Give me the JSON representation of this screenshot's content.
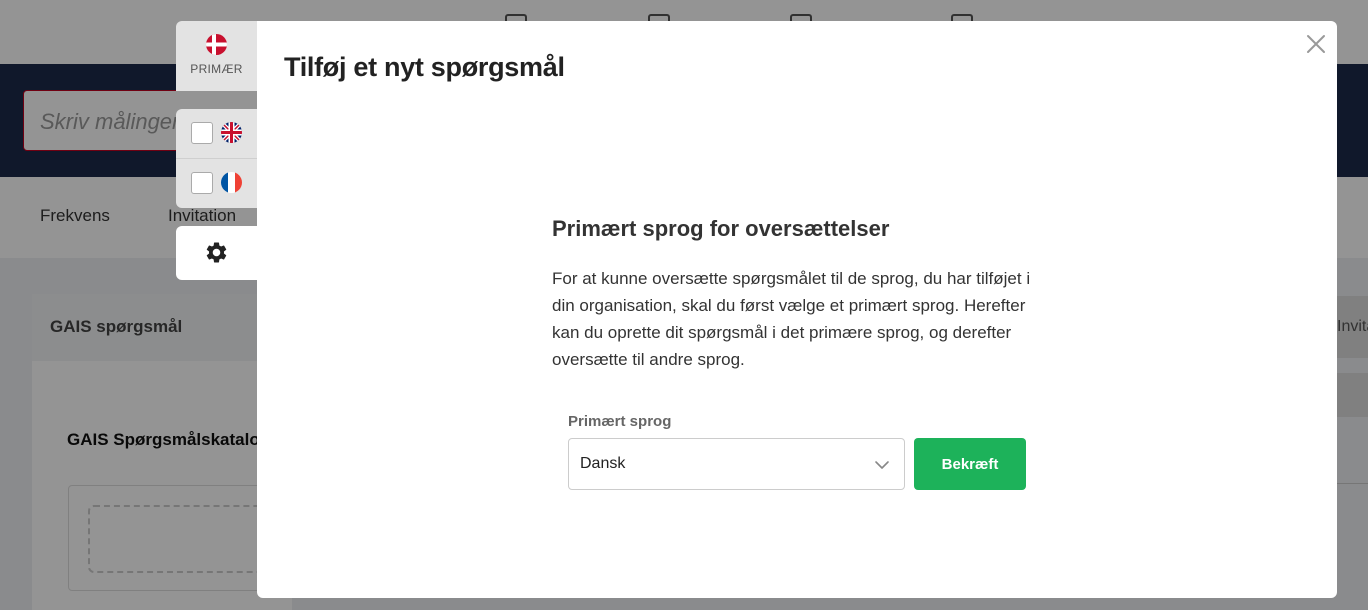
{
  "background": {
    "search_placeholder": "Skriv målingens",
    "tabs": [
      "Frekvens",
      "Invitation"
    ],
    "card_title": "GAIS spørgsmål",
    "catalog_title": "GAIS Spørgsmålskatalog",
    "right_button": "Invitat"
  },
  "language_panel": {
    "primary_label": "PRIMÆR",
    "primary_flag": "danish-flag-icon",
    "languages": [
      {
        "flag": "uk-flag-icon",
        "checked": false
      },
      {
        "flag": "french-flag-icon",
        "checked": false
      }
    ],
    "settings_icon": "gear-icon"
  },
  "modal": {
    "title": "Tilføj et nyt spørgsmål",
    "section_title": "Primært sprog for oversættelser",
    "description": "For at kunne oversætte spørgsmålet til de sprog, du har tilføjet i din organisation, skal du først vælge et primært sprog. Herefter kan du oprette dit spørgsmål i det primære sprog, og derefter oversætte til andre sprog.",
    "field_label": "Primært sprog",
    "select_value": "Dansk",
    "confirm_label": "Bekræft",
    "close_icon": "close-icon"
  },
  "colors": {
    "accent_green": "#1db25a",
    "danish_red": "#c8102e",
    "hero_navy": "#1c2a4a"
  }
}
